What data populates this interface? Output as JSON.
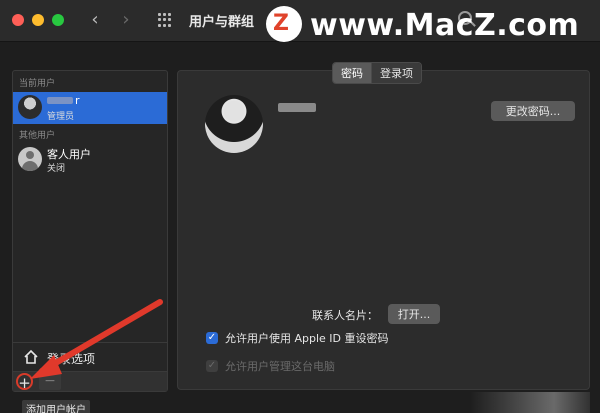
{
  "window": {
    "title": "用户与群组",
    "back": "‹",
    "forward": "›"
  },
  "watermark": {
    "badge": "Z",
    "text": "www.MacZ.com"
  },
  "sidebar": {
    "current_label": "当前用户",
    "current_user": {
      "name_suffix": "r",
      "role": "管理员"
    },
    "other_label": "其他用户",
    "guest_user": {
      "name": "客人用户",
      "status": "关闭"
    },
    "login_options": "登录选项",
    "add": "+",
    "remove": "−",
    "add_tooltip": "添加用户帐户"
  },
  "main": {
    "tabs": [
      {
        "label": "密码",
        "active": true
      },
      {
        "label": "登录项",
        "active": false
      }
    ],
    "change_password": "更改密码...",
    "contact_label": "联系人名片：",
    "open_button": "打开...",
    "checkbox_appleid": {
      "label": "允许用户使用 Apple ID 重设密码",
      "checked": true
    },
    "checkbox_admin": {
      "label": "允许用户管理这台电脑",
      "checked": true,
      "disabled": true
    }
  },
  "colors": {
    "accent": "#2b6bd6",
    "annotation": "#d83b2a"
  }
}
